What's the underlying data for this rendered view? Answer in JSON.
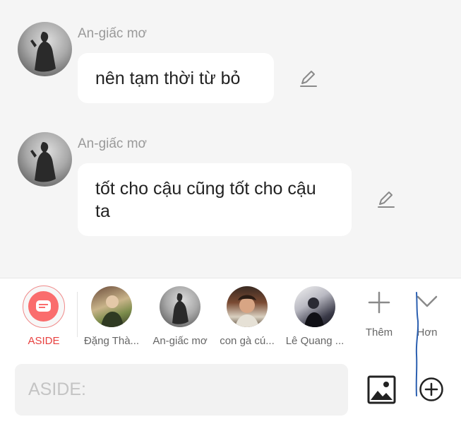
{
  "messages": [
    {
      "sender": "An-giấc mơ",
      "text": "nên tạm thời từ bỏ",
      "edit_icon": "pencil-icon"
    },
    {
      "sender": "An-giấc mơ",
      "text": "tốt cho cậu cũng tốt cho cậu ta",
      "edit_icon": "pencil-icon"
    }
  ],
  "contacts": {
    "aside": {
      "label": "ASIDE",
      "color": "#e8403f"
    },
    "people": [
      {
        "name": "Đặng Thà..."
      },
      {
        "name": "An-giấc mơ"
      },
      {
        "name": "con gà cú..."
      },
      {
        "name": "Lê Quang ..."
      }
    ],
    "more_label": "Thêm",
    "less_label": "Hơn"
  },
  "composer": {
    "placeholder": "ASIDE:",
    "image_icon": "image-icon",
    "add_icon": "plus-circle-icon"
  },
  "colors": {
    "accent": "#e8403f",
    "bubble": "#ffffff",
    "background": "#f5f5f5",
    "annotation_stroke": "#2b5fb0"
  }
}
